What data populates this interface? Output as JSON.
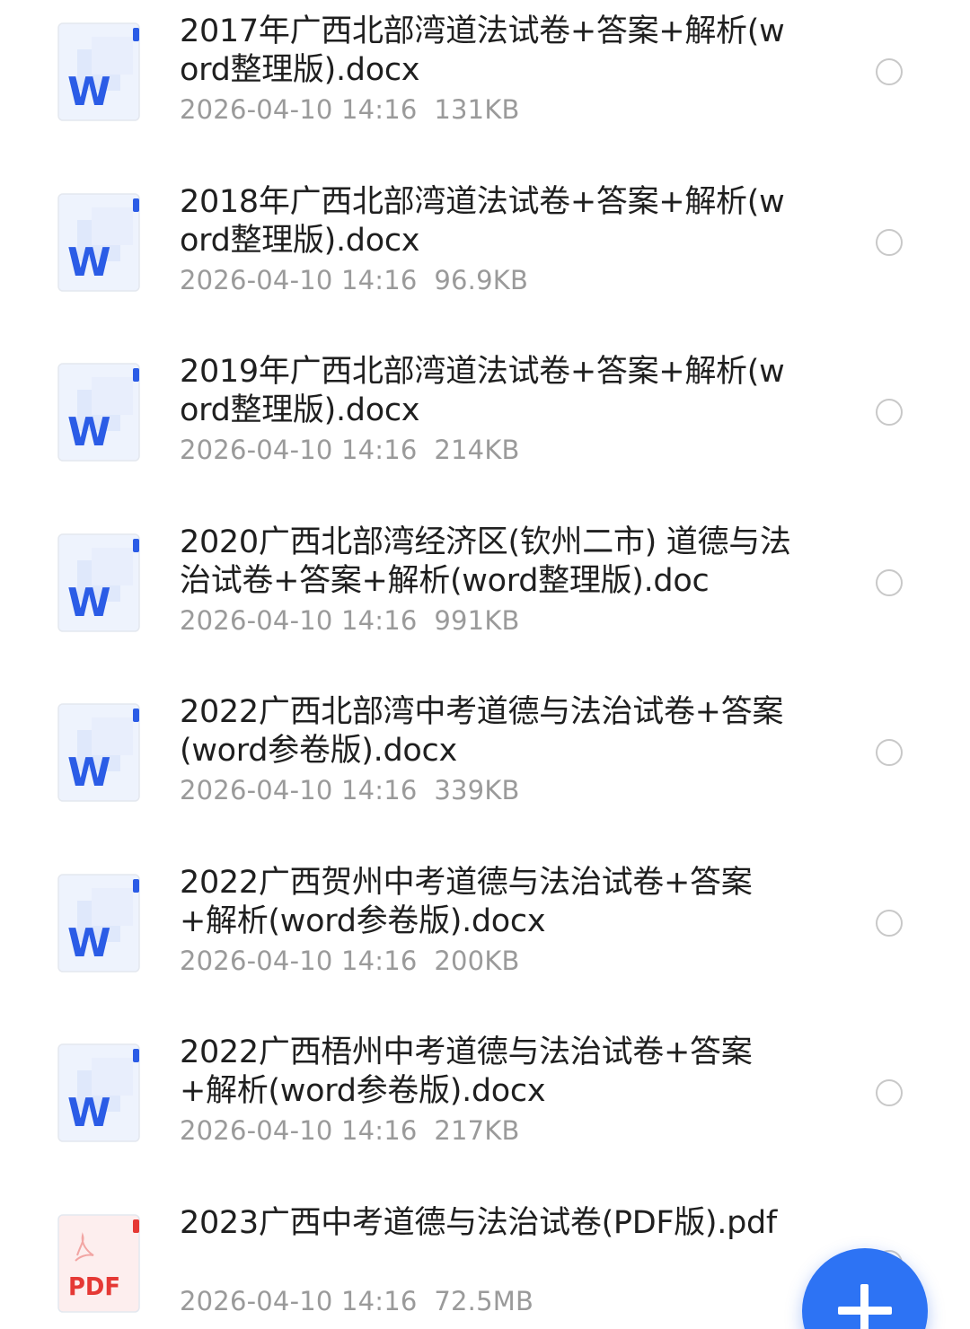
{
  "files": [
    {
      "type": "word",
      "name": "2017年广西北部湾道法试卷+答案+解析(word整理版).docx",
      "date": "2026-04-10 14:16",
      "size": "131KB",
      "selected": false
    },
    {
      "type": "word",
      "name": "2018年广西北部湾道法试卷+答案+解析(word整理版).docx",
      "date": "2026-04-10 14:16",
      "size": "96.9KB",
      "selected": false
    },
    {
      "type": "word",
      "name": "2019年广西北部湾道法试卷+答案+解析(word整理版).docx",
      "date": "2026-04-10 14:16",
      "size": "214KB",
      "selected": false
    },
    {
      "type": "word",
      "name": "2020广西北部湾经济区(钦州二市) 道德与法治试卷+答案+解析(word整理版).doc",
      "date": "2026-04-10 14:16",
      "size": "991KB",
      "selected": false
    },
    {
      "type": "word",
      "name": "2022广西北部湾中考道德与法治试卷+答案(word参卷版).docx",
      "date": "2026-04-10 14:16",
      "size": "339KB",
      "selected": false
    },
    {
      "type": "word",
      "name": "2022广西贺州中考道德与法治试卷+答案+解析(word参卷版).docx",
      "date": "2026-04-10 14:16",
      "size": "200KB",
      "selected": false
    },
    {
      "type": "word",
      "name": "2022广西梧州中考道德与法治试卷+答案+解析(word参卷版).docx",
      "date": "2026-04-10 14:16",
      "size": "217KB",
      "selected": false
    },
    {
      "type": "pdf",
      "name": "2023广西中考道德与法治试卷(PDF版).pdf",
      "date": "2026-04-10 14:16",
      "size": "72.5MB",
      "selected": false
    }
  ],
  "icons": {
    "word": {
      "letter": "W",
      "color": "#2b5ce6",
      "page_color": "#eef3fd"
    },
    "pdf": {
      "letter": "PDF",
      "color": "#e53935",
      "page_color": "#fdeeee"
    }
  },
  "fab": {
    "icon": "plus-icon",
    "color": "#2d73f4"
  },
  "colors": {
    "title": "#1f1f1f",
    "meta": "#9a9a9a",
    "radio_border": "#c8c8c8"
  }
}
